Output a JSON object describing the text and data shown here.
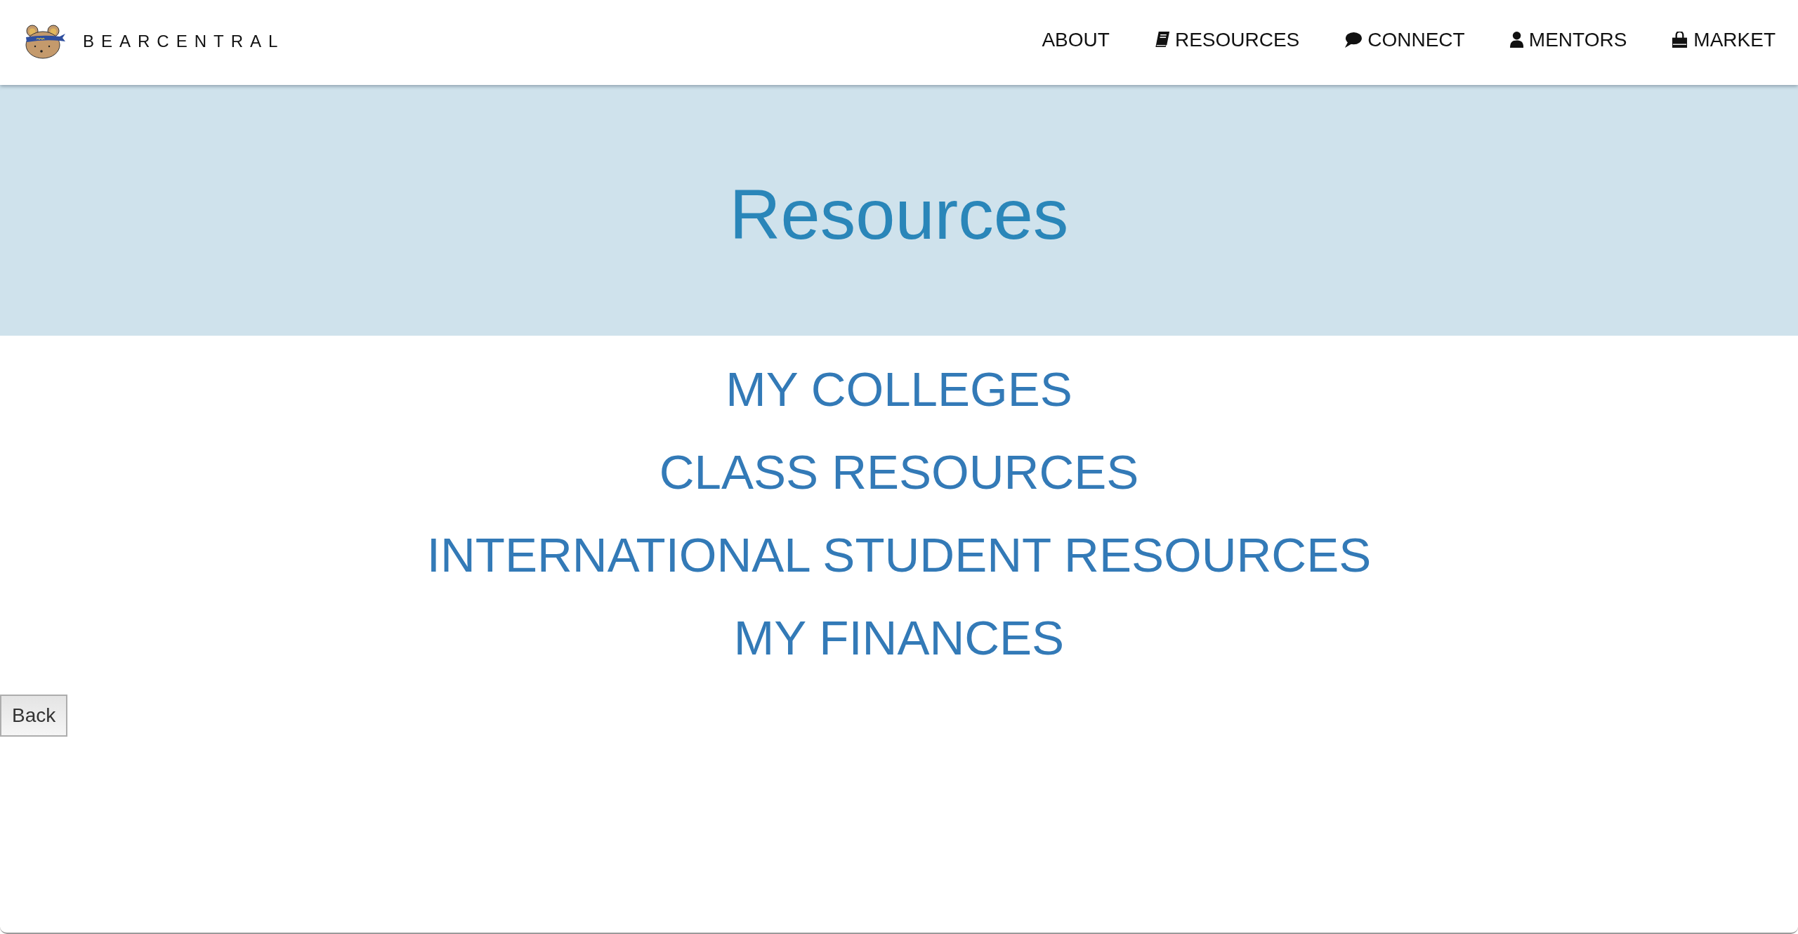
{
  "header": {
    "logo_text": "BEARCENTRAL",
    "nav": [
      {
        "label": "ABOUT",
        "kind": "plain"
      },
      {
        "label": "RESOURCES",
        "kind": "book"
      },
      {
        "label": "CONNECT",
        "kind": "chat"
      },
      {
        "label": "MENTORS",
        "kind": "person"
      },
      {
        "label": "MARKET",
        "kind": "bag"
      }
    ]
  },
  "hero": {
    "title": "Resources"
  },
  "resource_links": [
    "MY COLLEGES",
    "CLASS RESOURCES",
    "INTERNATIONAL STUDENT RESOURCES",
    "MY FINANCES"
  ],
  "back_button": "Back"
}
